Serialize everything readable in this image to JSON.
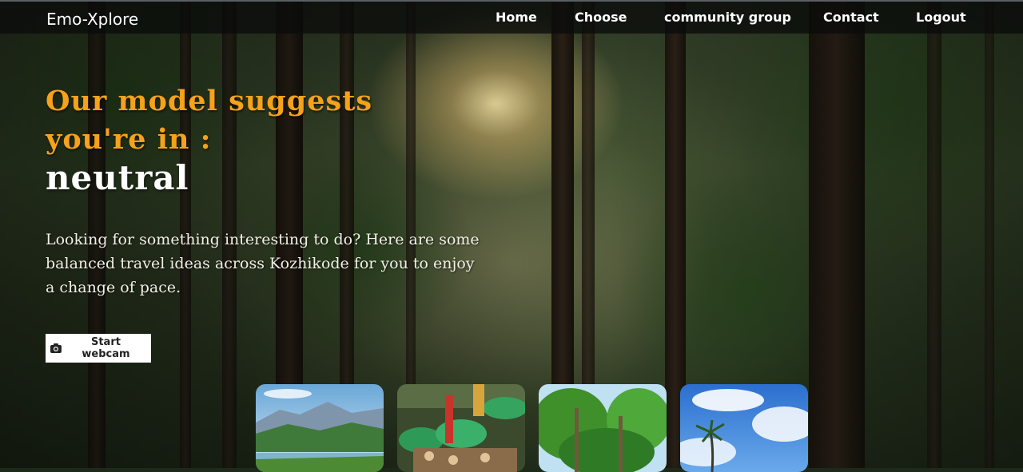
{
  "nav": {
    "brand": "Emo-Xplore",
    "links": [
      {
        "label": "Home"
      },
      {
        "label": "Choose"
      },
      {
        "label": "community group"
      },
      {
        "label": "Contact"
      },
      {
        "label": "Logout"
      }
    ]
  },
  "hero": {
    "headline_line1": "Our model suggests",
    "headline_line2": "you're in :",
    "emotion": "neutral",
    "description": "Looking for something interesting to do? Here are some balanced travel ideas across Kozhikode for you to enjoy a change of pace.",
    "webcam_button": "Start webcam",
    "webcam_icon": "camera-icon"
  },
  "colors": {
    "headline": "#f6a21a",
    "nav_bg": "#0a0c0a",
    "button_bg": "#ffffff"
  },
  "cards": [
    {
      "subject": "mountain-lake"
    },
    {
      "subject": "temple-festival"
    },
    {
      "subject": "coconut-palms"
    },
    {
      "subject": "palm-sky"
    }
  ]
}
